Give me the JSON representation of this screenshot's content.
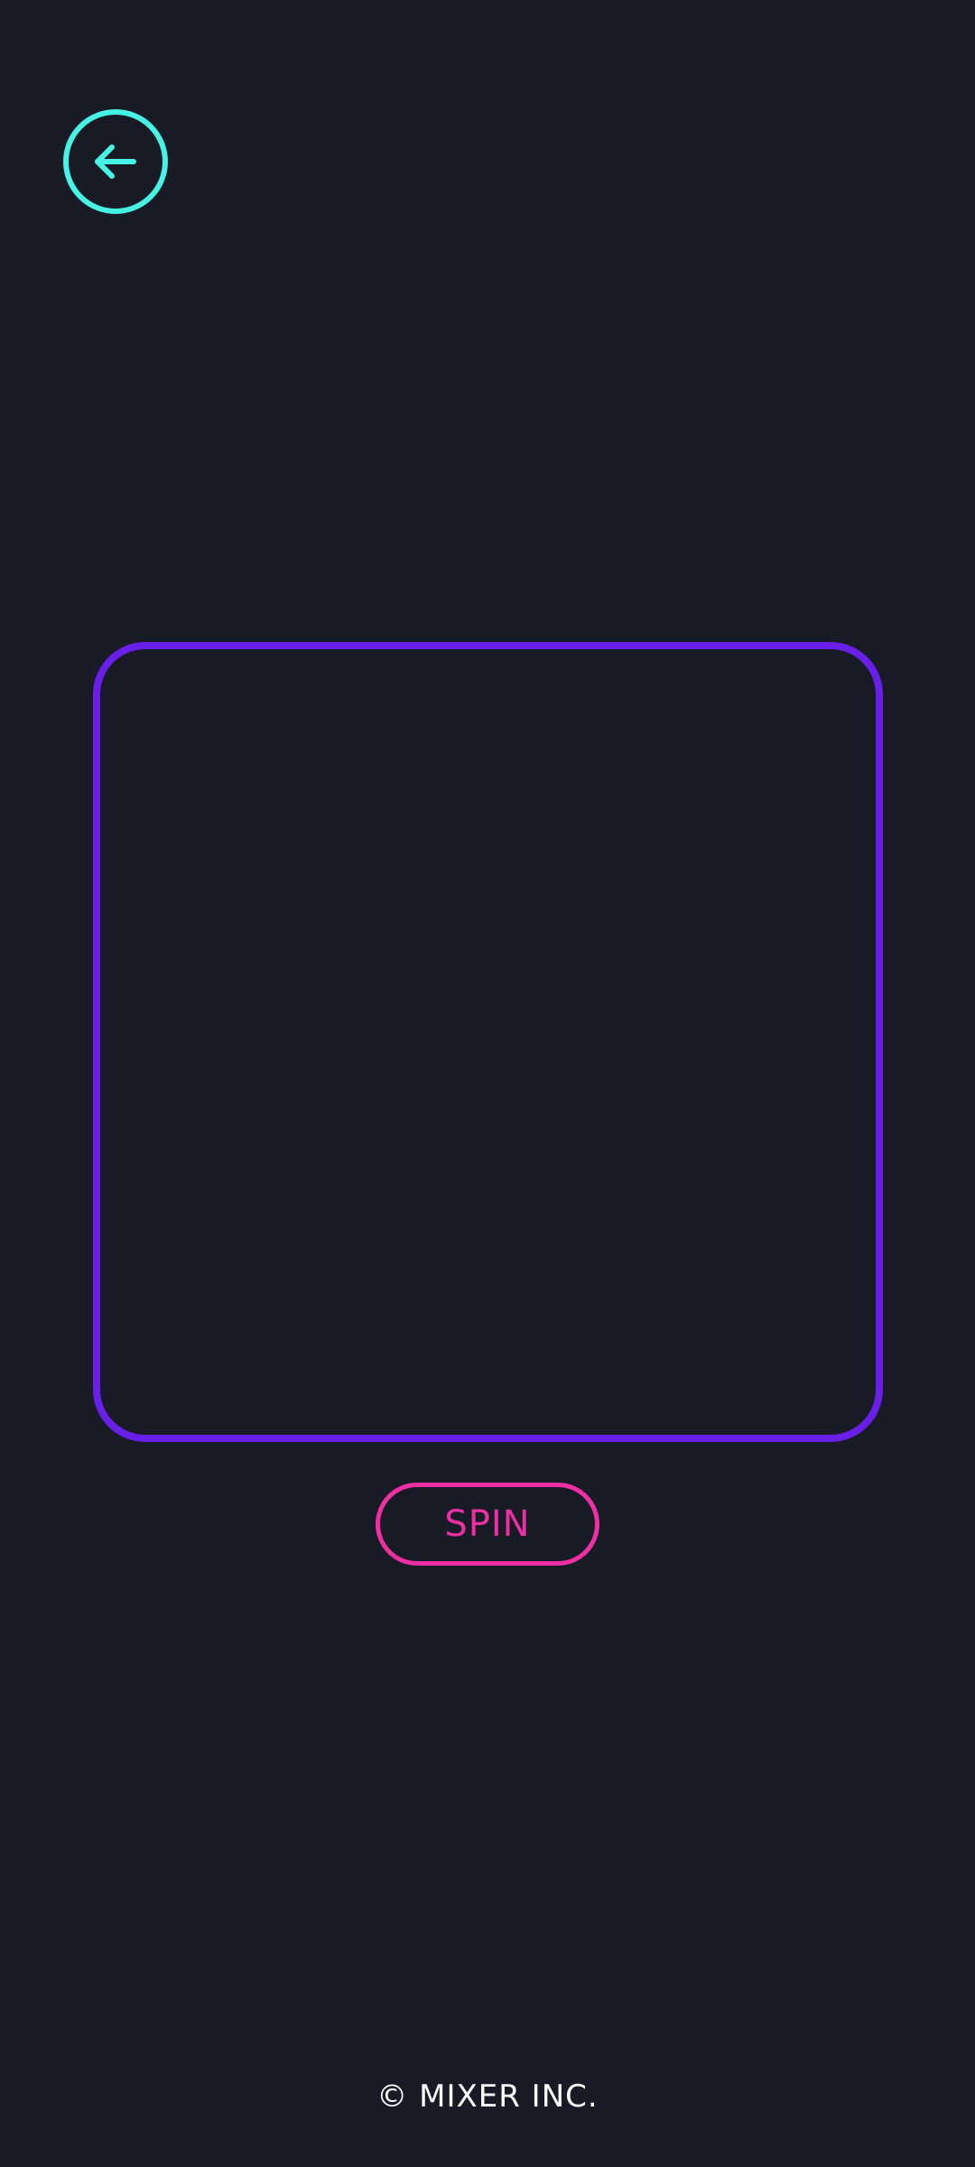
{
  "colors": {
    "background": "#181a25",
    "back_accent": "#45f2e3",
    "frame_accent": "#6a1fe8",
    "spin_accent": "#ec2fa3",
    "footer_text": "#ffffff"
  },
  "header": {
    "back_icon": "arrow-left-circle-icon"
  },
  "game": {
    "spin_label": "SPIN"
  },
  "footer": {
    "copyright": "© MIXER INC."
  }
}
